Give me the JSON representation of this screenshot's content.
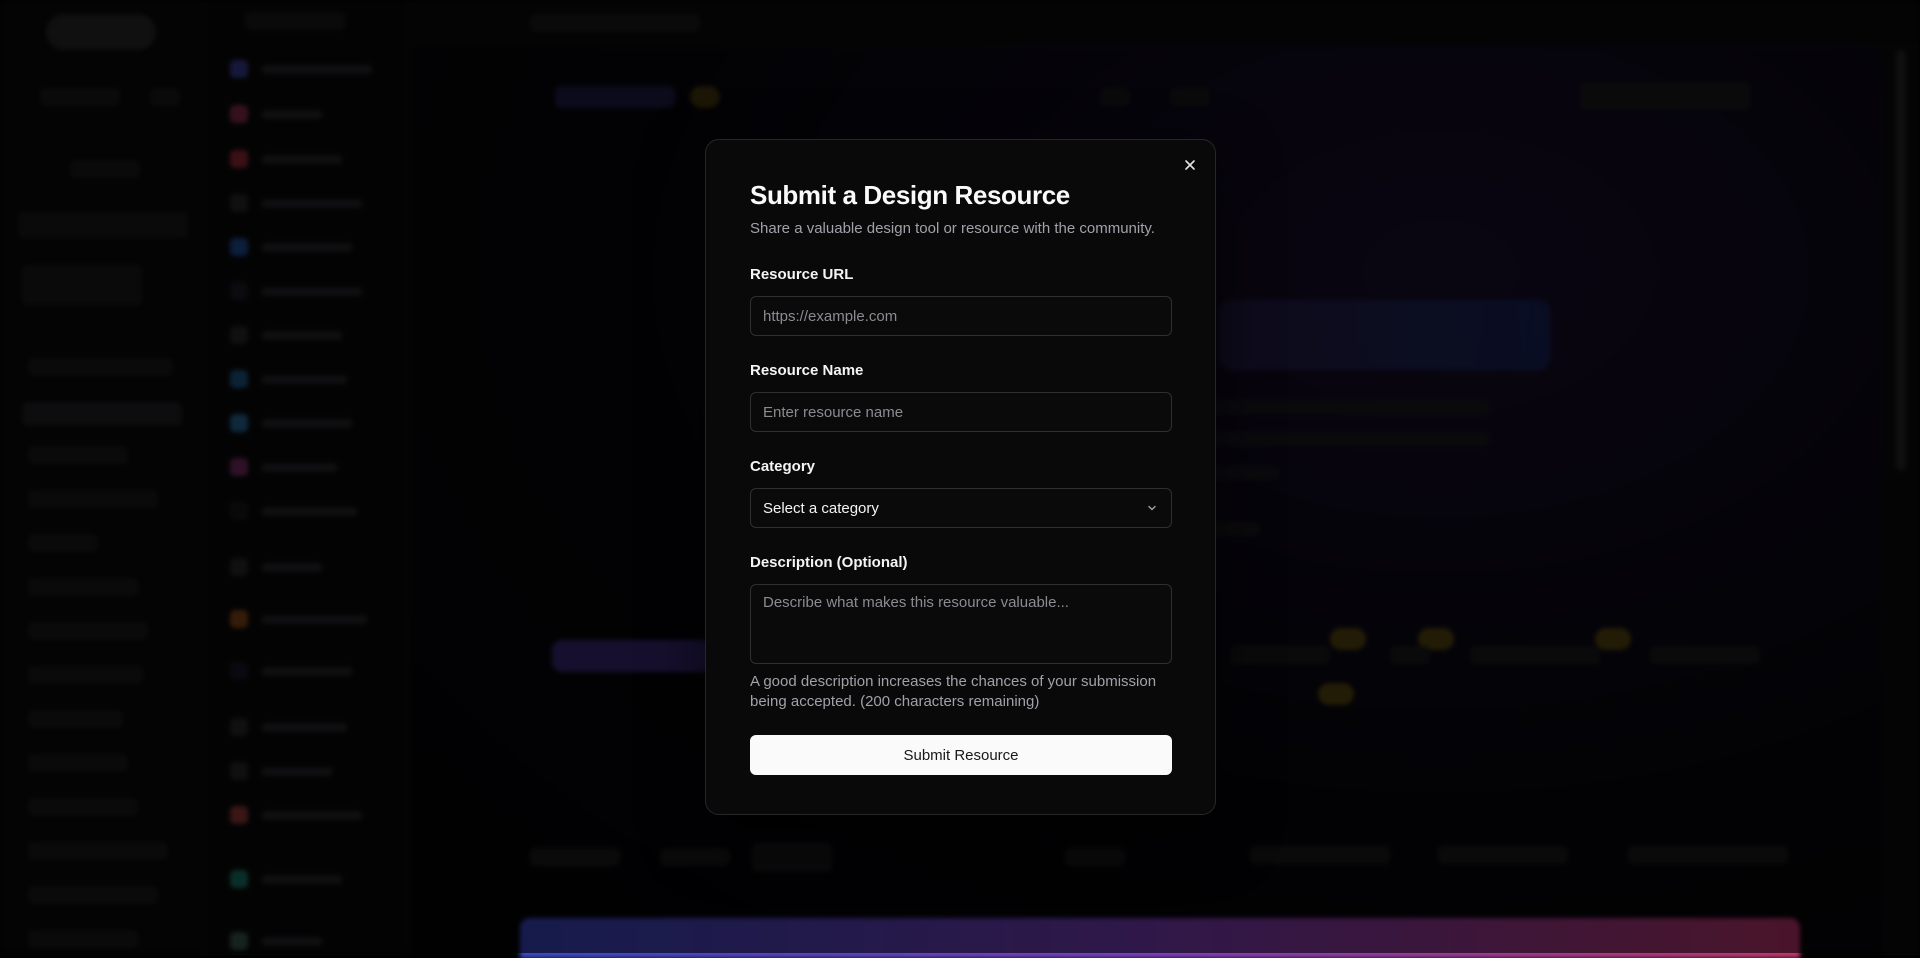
{
  "modal": {
    "title": "Submit a Design Resource",
    "subtitle": "Share a valuable design tool or resource with the community.",
    "close_icon": "close-icon",
    "fields": {
      "url": {
        "label": "Resource URL",
        "placeholder": "https://example.com",
        "value": ""
      },
      "name": {
        "label": "Resource Name",
        "placeholder": "Enter resource name",
        "value": ""
      },
      "category": {
        "label": "Category",
        "selected": "Select a category",
        "icon": "chevron-down-icon"
      },
      "description": {
        "label": "Description (Optional)",
        "placeholder": "Describe what makes this resource valuable...",
        "hint": "A good description increases the chances of your submission being accepted. (200 characters remaining)"
      }
    },
    "submit_label": "Submit Resource"
  },
  "colors": {
    "overlay": "#000000",
    "modal_bg": "#09090a",
    "border": "#27272a",
    "text_primary": "#fafafa",
    "text_muted": "#a1a1aa",
    "button_bg": "#fafafa"
  }
}
